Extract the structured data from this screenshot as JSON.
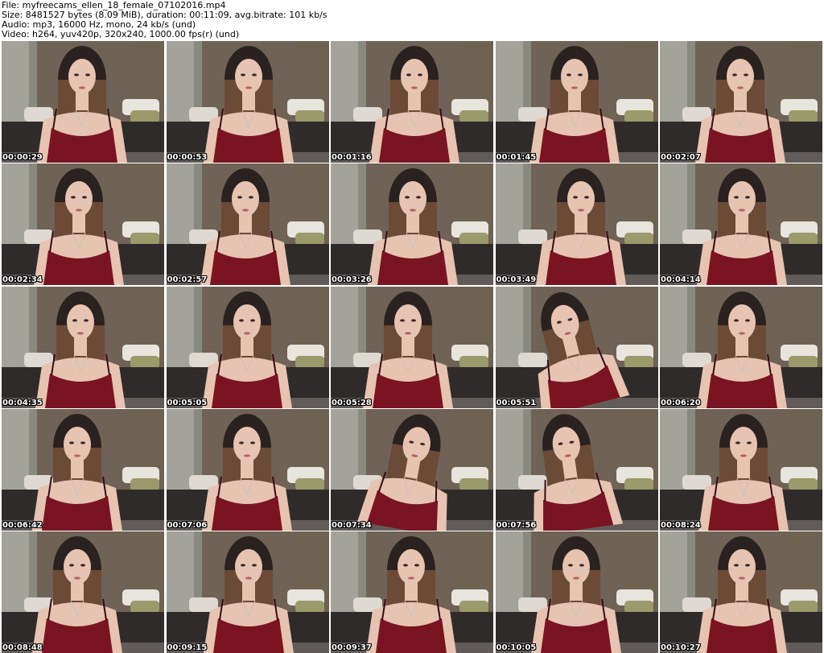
{
  "header": {
    "file_line": "File: myfreecams_ellen_18_female_07102016.mp4",
    "size_line": "Size: 8481527 bytes (8.09 MiB), duration: 00:11:09, avg.bitrate: 101 kb/s",
    "audio_line": "Audio: mp3, 16000 Hz, mono, 24 kb/s (und)",
    "video_line": "Video: h264, yuv420p, 320x240, 1000.00 fps(r) (und)"
  },
  "thumbnails": [
    {
      "time": "00:00:29"
    },
    {
      "time": "00:00:53"
    },
    {
      "time": "00:01:16"
    },
    {
      "time": "00:01:45"
    },
    {
      "time": "00:02:07"
    },
    {
      "time": "00:02:34"
    },
    {
      "time": "00:02:57"
    },
    {
      "time": "00:03:26"
    },
    {
      "time": "00:03:49"
    },
    {
      "time": "00:04:14"
    },
    {
      "time": "00:04:35"
    },
    {
      "time": "00:05:05"
    },
    {
      "time": "00:05:28"
    },
    {
      "time": "00:05:51"
    },
    {
      "time": "00:06:20"
    },
    {
      "time": "00:06:42"
    },
    {
      "time": "00:07:06"
    },
    {
      "time": "00:07:34"
    },
    {
      "time": "00:07:56"
    },
    {
      "time": "00:08:24"
    },
    {
      "time": "00:08:48"
    },
    {
      "time": "00:09:15"
    },
    {
      "time": "00:09:37"
    },
    {
      "time": "00:10:05"
    },
    {
      "time": "00:10:27"
    }
  ],
  "colors": {
    "wall": "#6b5f52",
    "curtain_green": "#c9cf9a",
    "curtain_gray": "#a3a39b",
    "bed_dark": "#2f2b2a",
    "top_red": "#7a1422",
    "hair": "#2a2220",
    "skin": "#e7c3b2"
  }
}
